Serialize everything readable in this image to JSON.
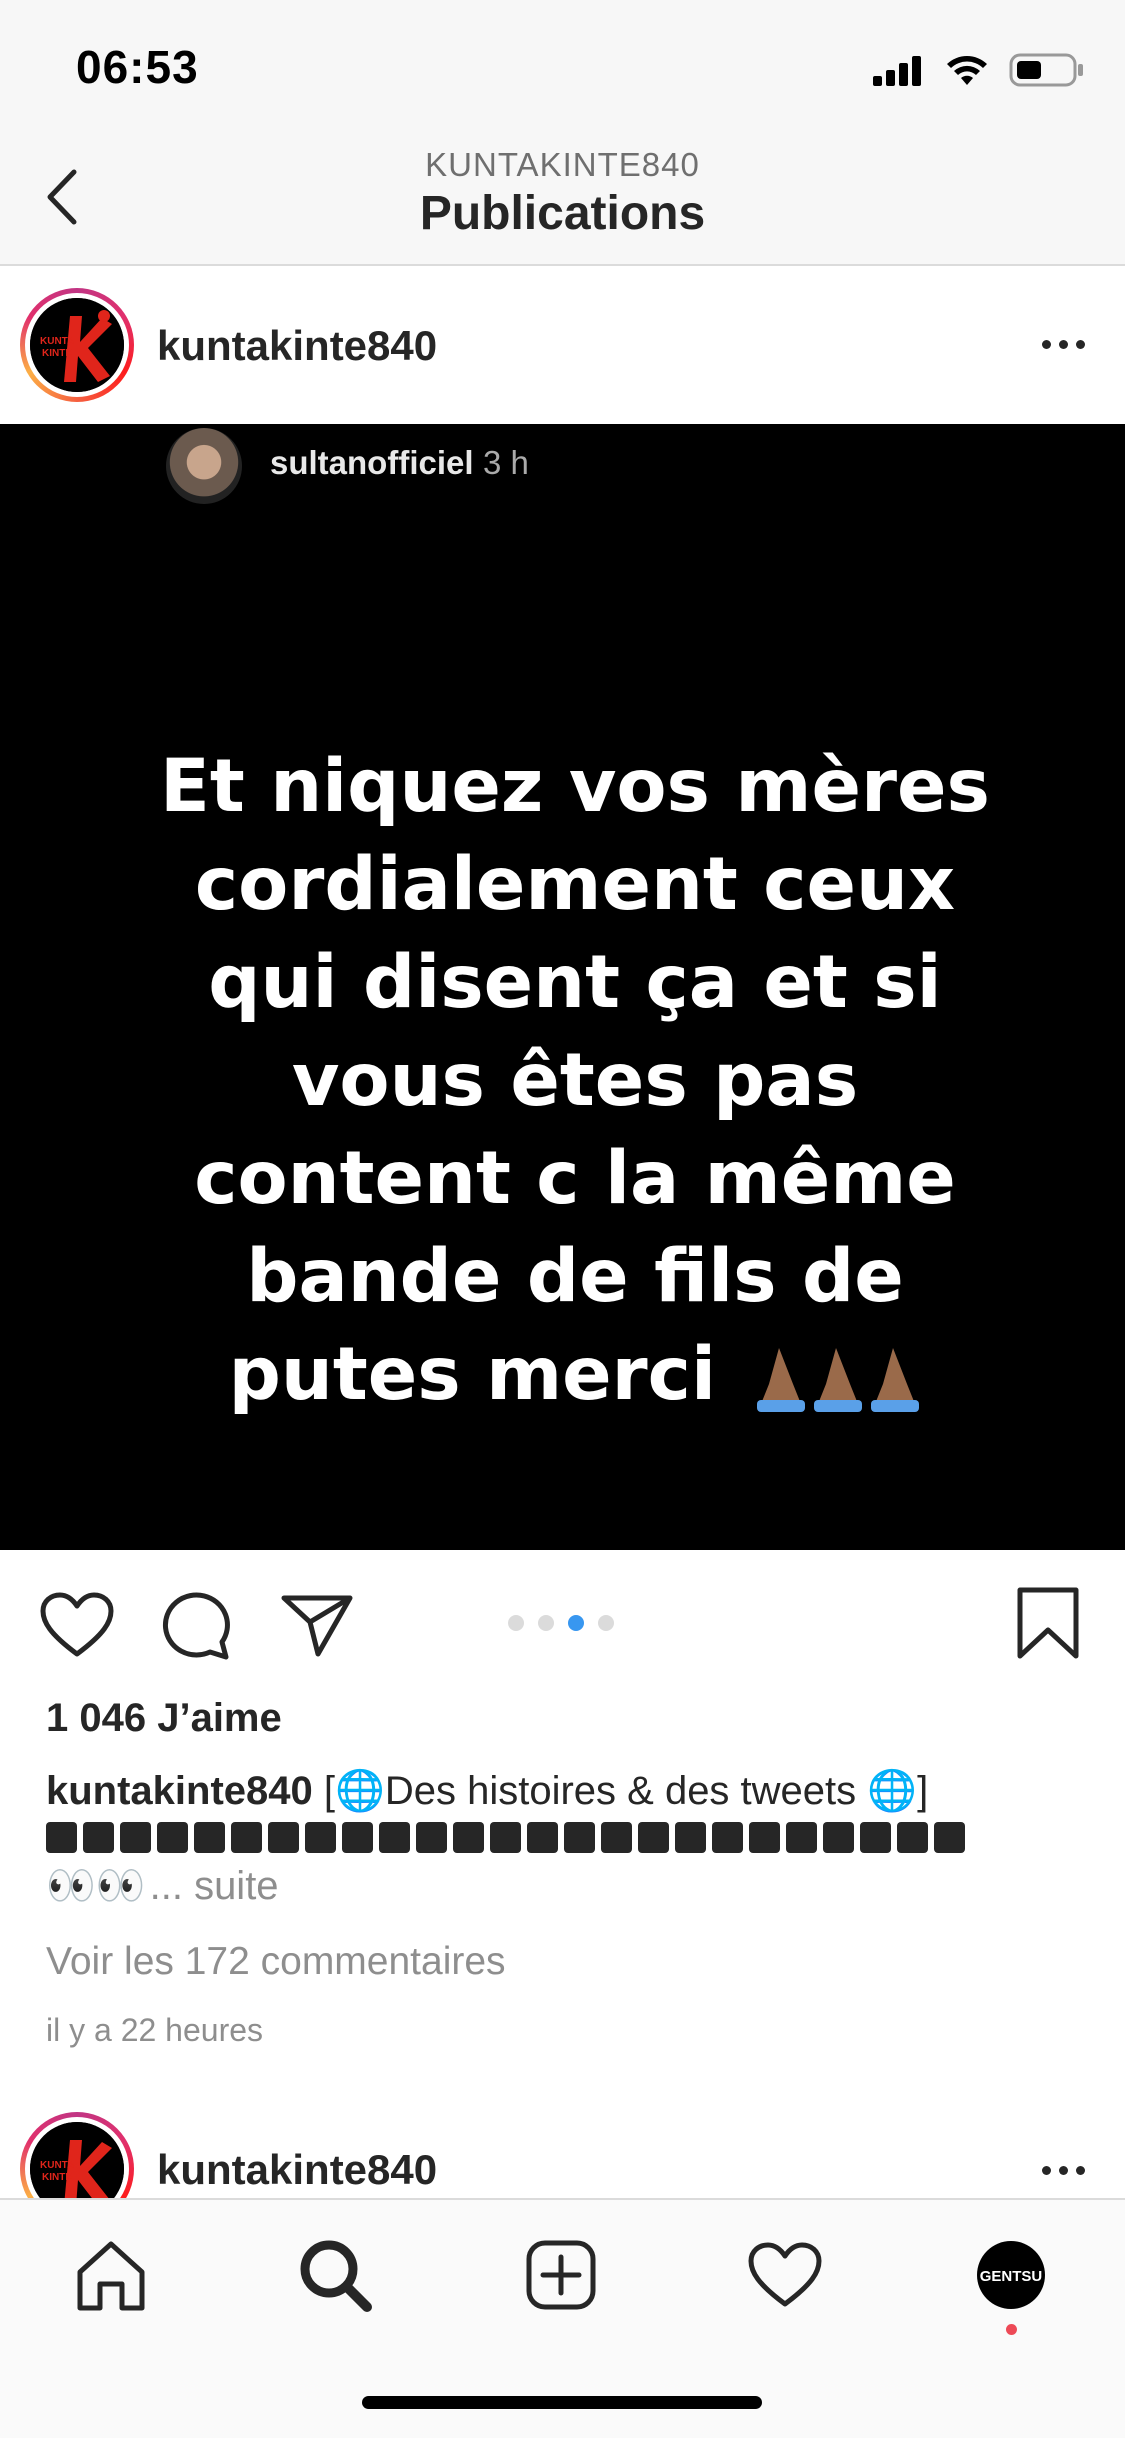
{
  "status_bar": {
    "time": "06:53"
  },
  "nav": {
    "subtitle": "KUNTAKINTE840",
    "title": "Publications"
  },
  "post": {
    "username": "kuntakinte840",
    "avatar_text": "KUNTA KINTE",
    "story": {
      "username": "sultanofficiel",
      "time": "3 h",
      "text": "Et niquez vos mères cordialement ceux qui disent ça et si vous êtes pas content c la même bande de fils de putes merci",
      "emoji": "🙏🏽🙏🏽🙏🏽"
    },
    "carousel": {
      "count": 4,
      "active_index": 2
    },
    "likes": "1 046 J’aime",
    "caption": {
      "username": "kuntakinte840",
      "text_prefix": "[",
      "globe1": "🌐",
      "text_middle": "Des histoires & des tweets ",
      "globe2": "🌐",
      "text_suffix": "]",
      "eyes": "👀👀",
      "more": "... suite"
    },
    "comments_link": "Voir les 172 commentaires",
    "time_ago": "il y a 22 heures"
  },
  "next_post": {
    "username": "kuntakinte840"
  },
  "tab_bar": {
    "items": [
      "home",
      "search",
      "new-post",
      "activity",
      "profile"
    ],
    "profile_avatar_text": "GENTSU"
  },
  "colors": {
    "link_blue": "#3897f0",
    "text": "#262626",
    "muted": "#8e8e8e",
    "notification_dot": "#ed4956"
  }
}
